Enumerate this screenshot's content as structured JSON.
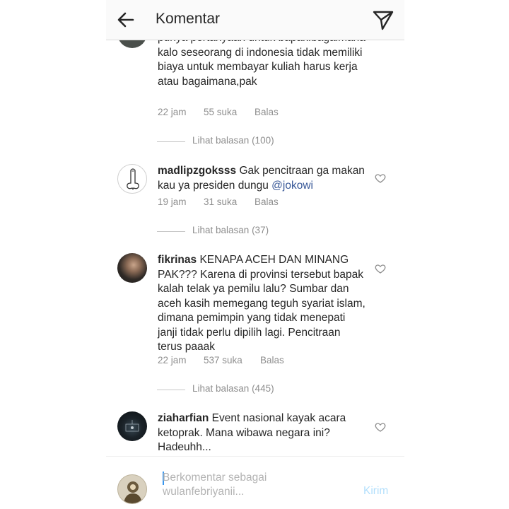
{
  "header": {
    "title": "Komentar"
  },
  "comments": [
    {
      "username": "",
      "text": "punya pertanyaan untuk bapak.bagaimana kalo seseorang  di indonesia tidak memiliki biaya untuk membayar kuliah harus kerja atau bagaimana,pak",
      "time": "22 jam",
      "likes": "55 suka",
      "reply": "Balas",
      "view_replies": "Lihat balasan (100)"
    },
    {
      "username": "madlipzgoksss",
      "text": "Gak pencitraan ga makan kau ya presiden dungu",
      "mention": "@jokowi",
      "time": "19 jam",
      "likes": "31 suka",
      "reply": "Balas",
      "view_replies": "Lihat balasan (37)"
    },
    {
      "username": "fikrinas",
      "text": "KENAPA ACEH DAN MINANG PAK??? Karena di provinsi tersebut bapak kalah telak ya pemilu lalu? Sumbar dan aceh kasih memegang teguh syariat islam, dimana pemimpin yang tidak menepati janji tidak perlu dipilih lagi. Pencitraan terus paaak",
      "time": "22 jam",
      "likes": "537 suka",
      "reply": "Balas",
      "view_replies": "Lihat balasan (445)"
    },
    {
      "username": "ziaharfian",
      "text": "Event nasional kayak acara ketoprak. Mana wibawa negara ini? Hadeuhh..."
    }
  ],
  "composer": {
    "placeholder": "Berkomentar sebagai wulanfebriyanii...",
    "send_label": "Kirim"
  },
  "icons": {
    "back": "arrow-left-icon",
    "direct": "paper-plane-icon",
    "like": "heart-outline-icon"
  },
  "colors": {
    "accent": "#3897f0",
    "mention": "#385898",
    "send_disabled": "#b2dffc"
  }
}
